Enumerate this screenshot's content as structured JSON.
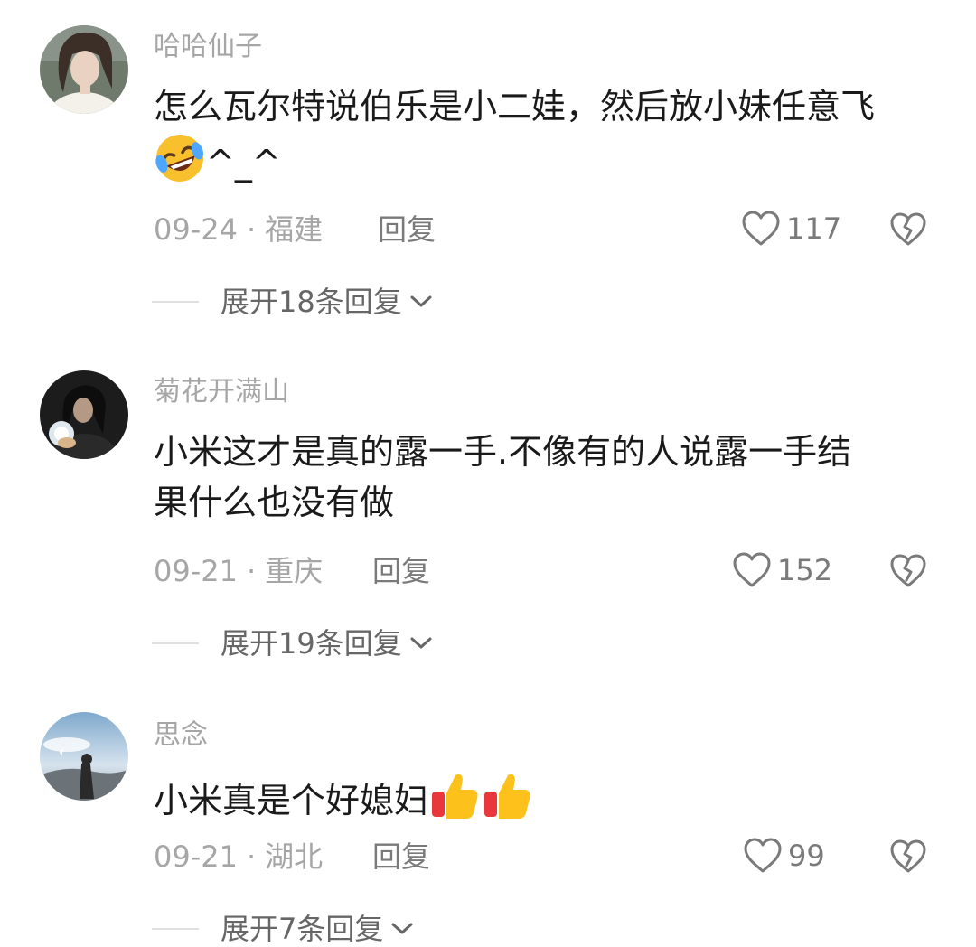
{
  "comments": [
    {
      "username": "哈哈仙子",
      "text_line1": "怎么瓦尔特说伯乐是小二娃，然后放小妹任意飞",
      "text_line2_suffix": "^_^",
      "date": "09-24",
      "location": "福建",
      "reply_label": "回复",
      "likes": "117",
      "expand_label": "展开18条回复"
    },
    {
      "username": "菊花开满山",
      "text_line1": "小米这才是真的露一手.不像有的人说露一手结",
      "text_line2": "果什么也没有做",
      "date": "09-21",
      "location": "重庆",
      "reply_label": "回复",
      "likes": "152",
      "expand_label": "展开19条回复"
    },
    {
      "username": "思念",
      "text_line1": "小米真是个好媳妇",
      "date": "09-21",
      "location": "湖北",
      "reply_label": "回复",
      "likes": "99",
      "expand_label": "展开7条回复"
    }
  ],
  "separator": "·",
  "icons": {
    "like": "heart-outline-icon",
    "dislike": "broken-heart-icon",
    "expand": "chevron-down-icon",
    "emoji_laugh": "rolling-laughing-emoji",
    "emoji_thumb": "thumbs-up-emoji"
  },
  "colors": {
    "meta_gray": "#a6a6a6",
    "text_dark": "#1a1a1a"
  }
}
